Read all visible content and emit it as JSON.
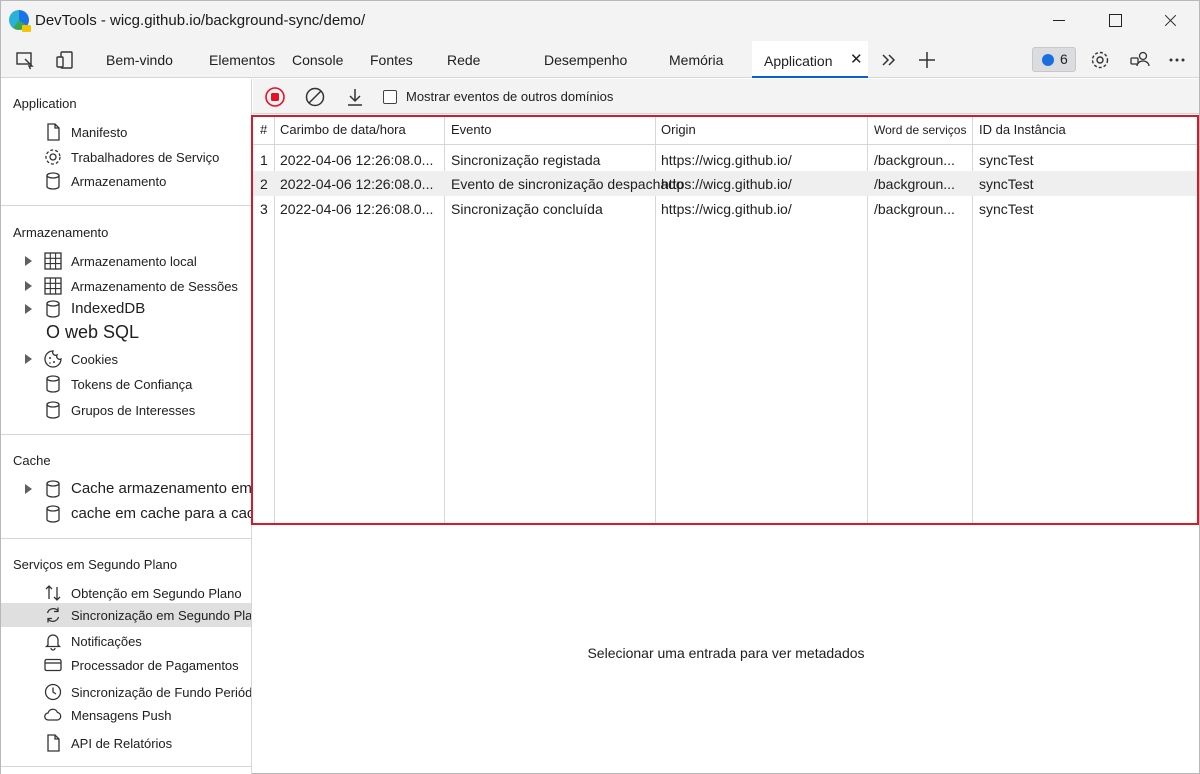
{
  "window": {
    "title": "DevTools - wicg.github.io/background-sync/demo/"
  },
  "tabs": [
    {
      "label": "Bem-vindo"
    },
    {
      "label": "Elementos"
    },
    {
      "label": "Console"
    },
    {
      "label": "Fontes"
    },
    {
      "label": "Rede"
    },
    {
      "label": "Desempenho"
    },
    {
      "label": "Memória"
    },
    {
      "label": "Application",
      "active": true
    }
  ],
  "issues": {
    "count": "6"
  },
  "sidebar": {
    "application": {
      "title": "Application",
      "items": [
        {
          "label": "Manifesto",
          "icon": "document-icon"
        },
        {
          "label": "Trabalhadores de Serviço",
          "icon": "gear-icon"
        },
        {
          "label": "Armazenamento",
          "icon": "database-icon"
        }
      ]
    },
    "storage": {
      "title": "Armazenamento",
      "items": [
        {
          "label": "Armazenamento local",
          "icon": "grid-icon"
        },
        {
          "label": "Armazenamento de Sessões",
          "icon": "grid-icon"
        },
        {
          "label": "IndexedDB",
          "icon": "database-icon"
        },
        {
          "label": "O web SQL",
          "icon": ""
        },
        {
          "label": "Cookies",
          "icon": "cookie-icon"
        },
        {
          "label": "Tokens de Confiança",
          "icon": "database-icon"
        },
        {
          "label": "Grupos de Interesses",
          "icon": "database-icon"
        }
      ]
    },
    "cache": {
      "title": "Cache",
      "items": [
        {
          "label": "Cache armazenamento em",
          "icon": "database-icon"
        },
        {
          "label": "cache em cache para a cache",
          "icon": "database-icon"
        }
      ]
    },
    "background": {
      "title": "Serviços em Segundo Plano",
      "items": [
        {
          "label": "Obtenção em Segundo Plano",
          "icon": "arrows-updown-icon"
        },
        {
          "label": "Sincronização em Segundo Plano",
          "icon": "sync-icon",
          "selected": true
        },
        {
          "label": "Notificações",
          "icon": "bell-icon"
        },
        {
          "label": "Processador de Pagamentos",
          "icon": "card-icon"
        },
        {
          "label": "Sincronização de Fundo Periódica",
          "icon": "clock-icon"
        },
        {
          "label": "Mensagens Push",
          "icon": "cloud-icon"
        },
        {
          "label": "API de Relatórios",
          "icon": "document-icon"
        }
      ]
    }
  },
  "toolbar": {
    "show_other_domains_label": "Mostrar eventos de outros domínios",
    "show_other_domains_checked": false
  },
  "grid": {
    "headers": [
      "#",
      "Carimbo de data/hora",
      "Evento",
      "Origin",
      "Word de serviços",
      "ID da Instância"
    ],
    "rows": [
      [
        "1",
        "2022-04-06 12:26:08.0...",
        "Sincronização registada",
        "https://wicg.github.io/",
        "/backgroun...",
        "syncTest"
      ],
      [
        "2",
        "2022-04-06 12:26:08.0...",
        "Evento de sincronização despachado",
        "https://wicg.github.io/",
        "/backgroun...",
        "syncTest"
      ],
      [
        "3",
        "2022-04-06 12:26:08.0...",
        "Sincronização concluída",
        "https://wicg.github.io/",
        "/backgroun...",
        "syncTest"
      ]
    ]
  },
  "details": {
    "placeholder": "Selecionar uma entrada para ver metadados"
  },
  "colors": {
    "accent": "#0a60d0",
    "highlight": "#d7192a",
    "record": "#e81123"
  }
}
